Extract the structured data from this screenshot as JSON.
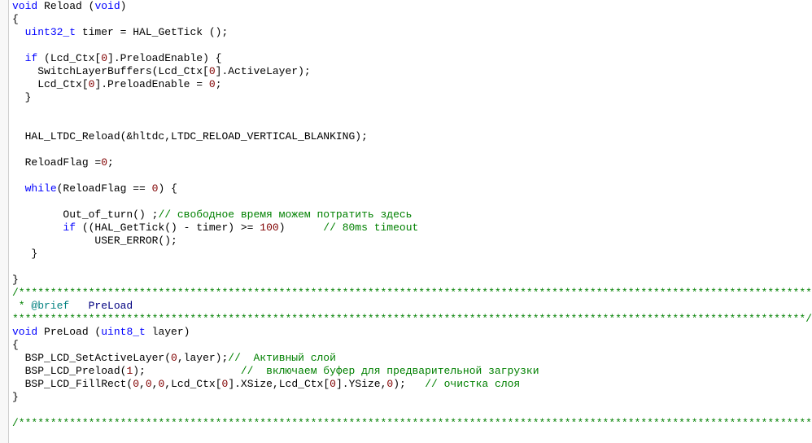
{
  "code": {
    "lines": [
      {
        "segments": [
          {
            "t": "void",
            "c": "kw"
          },
          {
            "t": " Reload (",
            "c": ""
          },
          {
            "t": "void",
            "c": "kw"
          },
          {
            "t": ")",
            "c": ""
          }
        ]
      },
      {
        "segments": [
          {
            "t": "{",
            "c": ""
          }
        ]
      },
      {
        "segments": [
          {
            "t": "  ",
            "c": ""
          },
          {
            "t": "uint32_t",
            "c": "type"
          },
          {
            "t": " timer = HAL_GetTick ();",
            "c": ""
          }
        ]
      },
      {
        "segments": [
          {
            "t": "",
            "c": ""
          }
        ]
      },
      {
        "segments": [
          {
            "t": "  ",
            "c": ""
          },
          {
            "t": "if",
            "c": "kw"
          },
          {
            "t": " (Lcd_Ctx[",
            "c": ""
          },
          {
            "t": "0",
            "c": "num"
          },
          {
            "t": "].PreloadEnable) {",
            "c": ""
          }
        ]
      },
      {
        "segments": [
          {
            "t": "    SwitchLayerBuffers(Lcd_Ctx[",
            "c": ""
          },
          {
            "t": "0",
            "c": "num"
          },
          {
            "t": "].ActiveLayer);",
            "c": ""
          }
        ]
      },
      {
        "segments": [
          {
            "t": "    Lcd_Ctx[",
            "c": ""
          },
          {
            "t": "0",
            "c": "num"
          },
          {
            "t": "].PreloadEnable = ",
            "c": ""
          },
          {
            "t": "0",
            "c": "num"
          },
          {
            "t": ";",
            "c": ""
          }
        ]
      },
      {
        "segments": [
          {
            "t": "  }",
            "c": ""
          }
        ]
      },
      {
        "segments": [
          {
            "t": "",
            "c": ""
          }
        ]
      },
      {
        "segments": [
          {
            "t": "",
            "c": ""
          }
        ]
      },
      {
        "segments": [
          {
            "t": "  HAL_LTDC_Reload(&hltdc,LTDC_RELOAD_VERTICAL_BLANKING);",
            "c": ""
          }
        ]
      },
      {
        "segments": [
          {
            "t": "",
            "c": ""
          }
        ]
      },
      {
        "segments": [
          {
            "t": "  ReloadFlag =",
            "c": ""
          },
          {
            "t": "0",
            "c": "num"
          },
          {
            "t": ";",
            "c": ""
          }
        ]
      },
      {
        "segments": [
          {
            "t": "",
            "c": ""
          }
        ]
      },
      {
        "segments": [
          {
            "t": "  ",
            "c": ""
          },
          {
            "t": "while",
            "c": "kw"
          },
          {
            "t": "(ReloadFlag == ",
            "c": ""
          },
          {
            "t": "0",
            "c": "num"
          },
          {
            "t": ") {",
            "c": ""
          }
        ]
      },
      {
        "segments": [
          {
            "t": "",
            "c": ""
          }
        ]
      },
      {
        "segments": [
          {
            "t": "        Out_of_turn() ;",
            "c": ""
          },
          {
            "t": "// свободное время можем потратить здесь",
            "c": "comment"
          }
        ]
      },
      {
        "segments": [
          {
            "t": "        ",
            "c": ""
          },
          {
            "t": "if",
            "c": "kw"
          },
          {
            "t": " ((HAL_GetTick() - timer) >= ",
            "c": ""
          },
          {
            "t": "100",
            "c": "num"
          },
          {
            "t": ")      ",
            "c": ""
          },
          {
            "t": "// 80ms timeout",
            "c": "comment"
          }
        ]
      },
      {
        "segments": [
          {
            "t": "             USER_ERROR();",
            "c": ""
          }
        ]
      },
      {
        "segments": [
          {
            "t": "   }",
            "c": ""
          }
        ]
      },
      {
        "segments": [
          {
            "t": "",
            "c": ""
          }
        ]
      },
      {
        "segments": [
          {
            "t": "}",
            "c": ""
          }
        ]
      },
      {
        "segments": [
          {
            "t": "/******************************************************************************************************************************",
            "c": "doccomment"
          }
        ]
      },
      {
        "segments": [
          {
            "t": " * ",
            "c": "doc-star"
          },
          {
            "t": "@brief",
            "c": "brief-tag"
          },
          {
            "t": "   ",
            "c": ""
          },
          {
            "t": "PreLoad",
            "c": "brief-word"
          }
        ]
      },
      {
        "segments": [
          {
            "t": "*****************************************************************************************************************************/",
            "c": "doccomment"
          }
        ]
      },
      {
        "segments": [
          {
            "t": "void",
            "c": "kw"
          },
          {
            "t": " PreLoad (",
            "c": ""
          },
          {
            "t": "uint8_t",
            "c": "type"
          },
          {
            "t": " layer)",
            "c": ""
          }
        ]
      },
      {
        "segments": [
          {
            "t": "{",
            "c": ""
          }
        ]
      },
      {
        "segments": [
          {
            "t": "  BSP_LCD_SetActiveLayer(",
            "c": ""
          },
          {
            "t": "0",
            "c": "num"
          },
          {
            "t": ",layer);",
            "c": ""
          },
          {
            "t": "//  Активный слой",
            "c": "comment"
          }
        ]
      },
      {
        "segments": [
          {
            "t": "  BSP_LCD_Preload(",
            "c": ""
          },
          {
            "t": "1",
            "c": "num"
          },
          {
            "t": ");               ",
            "c": ""
          },
          {
            "t": "//  включаем буфер для предварительной загрузки",
            "c": "comment"
          }
        ]
      },
      {
        "segments": [
          {
            "t": "  BSP_LCD_FillRect(",
            "c": ""
          },
          {
            "t": "0",
            "c": "num"
          },
          {
            "t": ",",
            "c": ""
          },
          {
            "t": "0",
            "c": "num"
          },
          {
            "t": ",",
            "c": ""
          },
          {
            "t": "0",
            "c": "num"
          },
          {
            "t": ",Lcd_Ctx[",
            "c": ""
          },
          {
            "t": "0",
            "c": "num"
          },
          {
            "t": "].XSize,Lcd_Ctx[",
            "c": ""
          },
          {
            "t": "0",
            "c": "num"
          },
          {
            "t": "].YSize,",
            "c": ""
          },
          {
            "t": "0",
            "c": "num"
          },
          {
            "t": ");   ",
            "c": ""
          },
          {
            "t": "// очистка слоя",
            "c": "comment"
          }
        ]
      },
      {
        "segments": [
          {
            "t": "}",
            "c": ""
          }
        ]
      },
      {
        "segments": [
          {
            "t": "",
            "c": ""
          }
        ]
      },
      {
        "segments": [
          {
            "t": "/******************************************************************************************************************************",
            "c": "doccomment"
          }
        ]
      }
    ]
  }
}
